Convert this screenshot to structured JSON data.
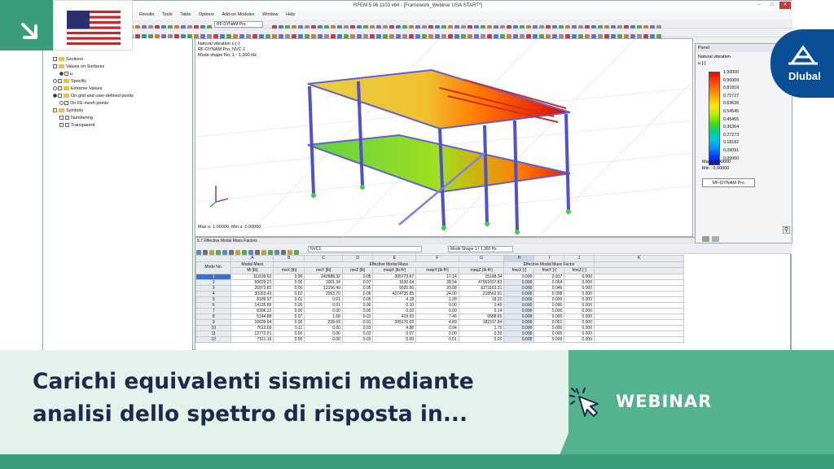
{
  "app": {
    "title": "RFEM 5.06.1103 x64 - [Framework_Webinar USA-START*]",
    "menu": [
      "Results",
      "Tools",
      "Table",
      "Options",
      "Add-on Modules",
      "Window",
      "Help"
    ],
    "module_combo": "RF-DYNAM Pro"
  },
  "navigator": {
    "items": [
      {
        "label": "Sections",
        "type": "folder"
      },
      {
        "label": "Values on Surfaces",
        "type": "folder"
      },
      {
        "label": "u",
        "type": "radio"
      },
      {
        "label": "Specific",
        "type": "folder"
      },
      {
        "label": "Extreme Values",
        "type": "folder"
      },
      {
        "label": "On grid and user-defined points",
        "type": "radio"
      },
      {
        "label": "On FE mesh points",
        "type": "radio"
      },
      {
        "label": "Symbols",
        "type": "folder"
      },
      {
        "label": "Numbering",
        "type": "check"
      },
      {
        "label": "Transparent",
        "type": "check"
      }
    ]
  },
  "viewport": {
    "info": [
      "Natural vibration u [-]",
      "RF-DYNAM Pro, NVC 1",
      "Mode shape No. 1 - 1.300 Hz"
    ],
    "footer": "Max u: 1.00000, Min u: 0.00000"
  },
  "panel": {
    "title": "Panel",
    "subtitle": "Natural vibration",
    "unit": "u [-]",
    "legend": [
      "1.00000",
      "0.90909",
      "0.81818",
      "0.72727",
      "0.63636",
      "0.54545",
      "0.45455",
      "0.36364",
      "0.27273",
      "0.18182",
      "0.09091",
      "0.00000"
    ],
    "legend_colors": [
      "#ff0000",
      "#ff3c00",
      "#ff7a00",
      "#ffb400",
      "#ffe600",
      "#b8f000",
      "#50e000",
      "#00d080",
      "#00c8e0",
      "#0090ff",
      "#0040ff",
      "#1010c0"
    ],
    "max_label": "Max :",
    "max_value": "1.00000",
    "min_label": "Min :",
    "min_value": "0.00000",
    "button": "RF-DYNAM Pro"
  },
  "table": {
    "window_title": "5.7 Effective Modal Mass Factors",
    "nvc_combo": "NVC1",
    "mode_combo": "Mode Shape 1 / 1.300 Hz",
    "letters": [
      "A",
      "B",
      "C",
      "D",
      "E",
      "F",
      "G",
      "H",
      "I",
      "J",
      "K"
    ],
    "group_headers": [
      "Modal Mass",
      "Effective Modal Mass",
      "Effective Modal Mass Factor"
    ],
    "col_headers": [
      "Mode No.",
      "Mi [lb]",
      "meX [lb]",
      "meY [lb]",
      "meZ [lb]",
      "meφX [lb ft²]",
      "meφY [lb ft²]",
      "meφZ [lb ft²]",
      "fmeX [-]",
      "fmeY [-]",
      "fmeZ [-]"
    ],
    "rows": [
      [
        "1",
        "111199.62",
        "0.00",
        "242688.32",
        "0.05",
        "305773.67",
        "17.14",
        "15168.34",
        "0.000",
        "0.917",
        "0.000"
      ],
      [
        "2",
        "93029.21",
        "0.00",
        "1001.34",
        "0.07",
        "1630.64",
        "28.54",
        "47061657.83",
        "0.000",
        "0.004",
        "0.000"
      ],
      [
        "3",
        "26073.82",
        "0.00",
        "12156.49",
        "0.05",
        "9935.66",
        "20.08",
        "6271163.31",
        "0.000",
        "0.046",
        "0.000"
      ],
      [
        "4",
        "30263.43",
        "0.02",
        "2093.70",
        "0.06",
        "4374735.85",
        "24.00",
        "218562.91",
        "0.000",
        "0.008",
        "0.000"
      ],
      [
        "5",
        "8189.97",
        "0.01",
        "0.01",
        "0.05",
        "4.18",
        "1.28",
        "18.20",
        "0.000",
        "0.000",
        "0.000"
      ],
      [
        "6",
        "14135.86",
        "0.00",
        "0.01",
        "0.00",
        "0.10",
        "0.00",
        "0.49",
        "0.000",
        "0.000",
        "0.000"
      ],
      [
        "7",
        "8396.22",
        "0.00",
        "0.00",
        "0.00",
        "0.03",
        "0.00",
        "0.14",
        "0.000",
        "0.000",
        "0.000"
      ],
      [
        "8",
        "5144.88",
        "0.07",
        "1.68",
        "0.01",
        "419.03",
        "7.46",
        "6588.65",
        "0.000",
        "0.000",
        "0.000"
      ],
      [
        "9",
        "10699.94",
        "0.00",
        "228.69",
        "0.01",
        "205176.69",
        "4.89",
        "182317.84",
        "0.000",
        "0.001",
        "0.000"
      ],
      [
        "10",
        "7612.69",
        "0.11",
        "0.00",
        "0.03",
        "4.88",
        "0.94",
        "1.70",
        "0.000",
        "0.000",
        "0.000"
      ],
      [
        "11",
        "12772.91",
        "0.00",
        "0.00",
        "0.03",
        "0.07",
        "0.00",
        "0.39",
        "0.000",
        "0.000",
        "0.000"
      ],
      [
        "12",
        "7511.16",
        "0.00",
        "0.00",
        "0.03",
        "0.00",
        "0.01",
        "0.00",
        "0.000",
        "0.000",
        "0.000"
      ]
    ]
  },
  "banner": {
    "headline_line1": "Carichi equivalenti sismici mediante",
    "headline_line2": "analisi dello spettro di risposta in...",
    "webinar": "WEBINAR"
  },
  "logo": {
    "text": "Dlubal"
  },
  "colors": {
    "green": "#3a9c78",
    "light_green": "#e3f3ec",
    "mid_green": "#54b28e",
    "logo_blue": "#0a4f95",
    "navy_text": "#1e2a4a"
  }
}
